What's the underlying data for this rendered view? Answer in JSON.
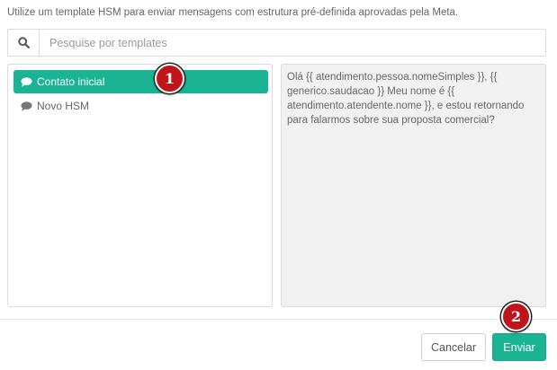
{
  "intro_text": "Utilize um template HSM para enviar mensagens com estrutura pré-definida aprovadas pela Meta.",
  "search": {
    "icon": "search-icon",
    "placeholder": "Pesquise por templates"
  },
  "templates": {
    "items": [
      {
        "label": "Contato inicial",
        "icon": "chat-bubble-icon",
        "selected": true
      },
      {
        "label": "Novo HSM",
        "icon": "chat-bubble-icon",
        "selected": false
      }
    ]
  },
  "preview": {
    "text": "Olá {{ atendimento.pessoa.nomeSimples }}, {{ generico.saudacao }} Meu nome é {{ atendimento.atendente.nome }}, e estou retornando para falarmos sobre sua proposta comercial?"
  },
  "footer": {
    "cancel_label": "Cancelar",
    "send_label": "Enviar"
  },
  "annotations": {
    "badge_1": "1",
    "badge_2": "2"
  },
  "colors": {
    "accent": "#1ab394",
    "badge": "#c0141b",
    "preview_bg": "#f1f1f1"
  }
}
